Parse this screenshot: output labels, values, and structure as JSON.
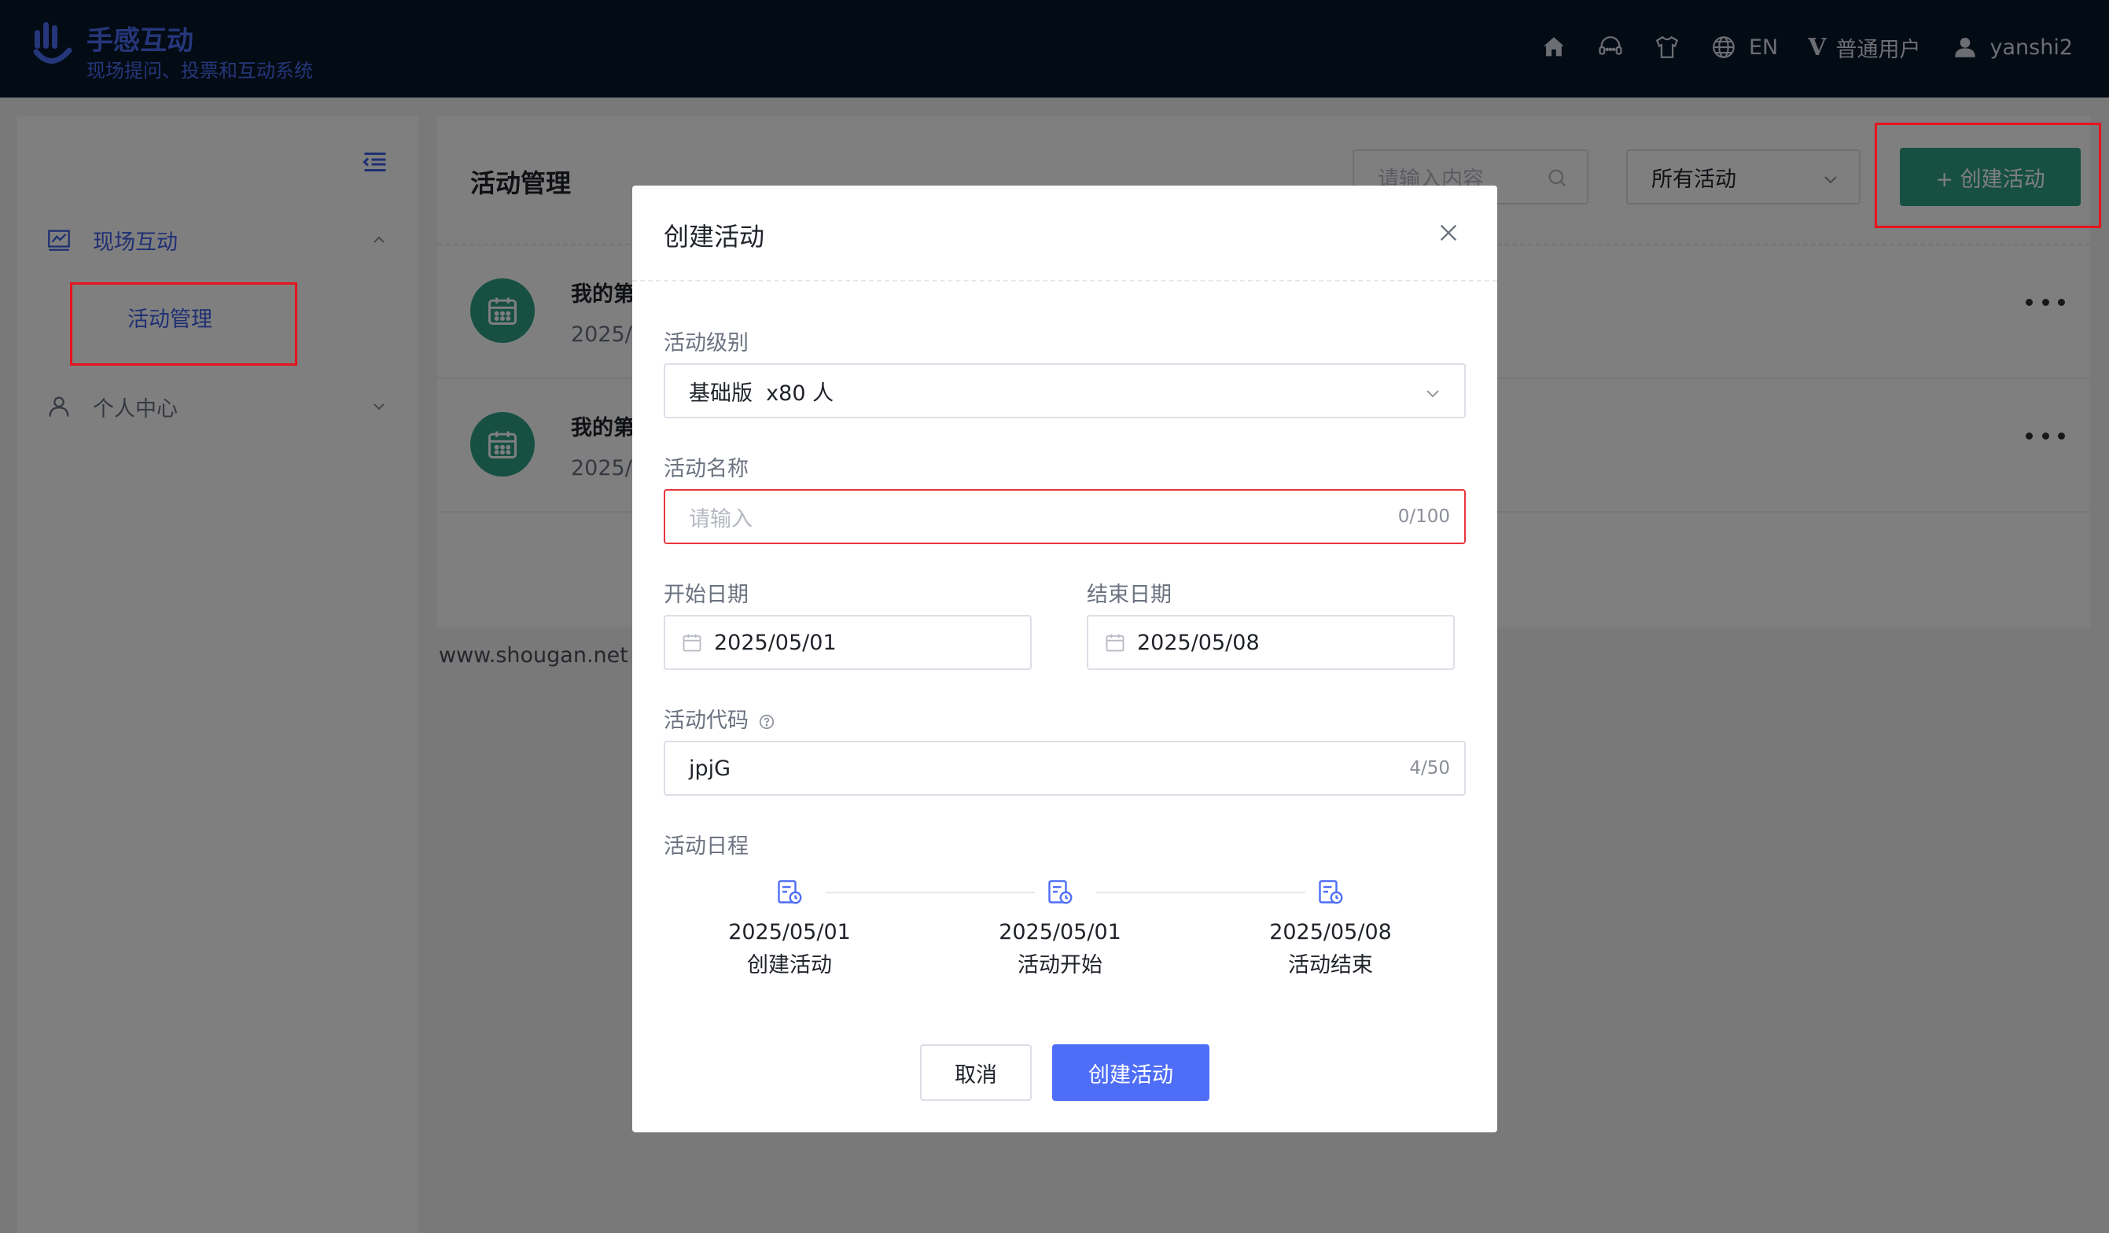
{
  "header": {
    "logo_title": "手感互动",
    "logo_subtitle": "现场提问、投票和互动系统",
    "language": "EN",
    "vip_mark": "V",
    "user_level": "普通用户",
    "username": "yanshi2"
  },
  "sidebar": {
    "items": [
      {
        "label": "现场互动",
        "icon": "chart-icon",
        "expanded": true
      },
      {
        "label": "活动管理",
        "active": true
      },
      {
        "label": "个人中心",
        "icon": "user-icon",
        "expanded": false
      }
    ]
  },
  "main": {
    "title": "活动管理",
    "search_placeholder": "请输入内容",
    "filter_value": "所有活动",
    "create_button": "+ 创建活动",
    "activities": [
      {
        "name": "我的第",
        "date": "2025/("
      },
      {
        "name": "我的第",
        "date": "2025/("
      }
    ],
    "footer_link": "www.shougan.net"
  },
  "dialog": {
    "title": "创建活动",
    "level_label": "活动级别",
    "level_value": "基础版  x80 人",
    "name_label": "活动名称",
    "name_placeholder": "请输入",
    "name_count": "0/100",
    "start_label": "开始日期",
    "start_value": "2025/05/01",
    "end_label": "结束日期",
    "end_value": "2025/05/08",
    "code_label": "活动代码",
    "code_value": "jpjG",
    "code_count": "4/50",
    "schedule_label": "活动日程",
    "schedule": [
      {
        "date": "2025/05/01",
        "label": "创建活动"
      },
      {
        "date": "2025/05/01",
        "label": "活动开始"
      },
      {
        "date": "2025/05/08",
        "label": "活动结束"
      }
    ],
    "cancel_button": "取消",
    "submit_button": "创建活动"
  },
  "colors": {
    "header_bg": "#071628",
    "brand_blue": "#4b6cf5",
    "primary_button": "#4f6ef7",
    "green": "#2fa187",
    "highlight_red": "#e6141e"
  }
}
